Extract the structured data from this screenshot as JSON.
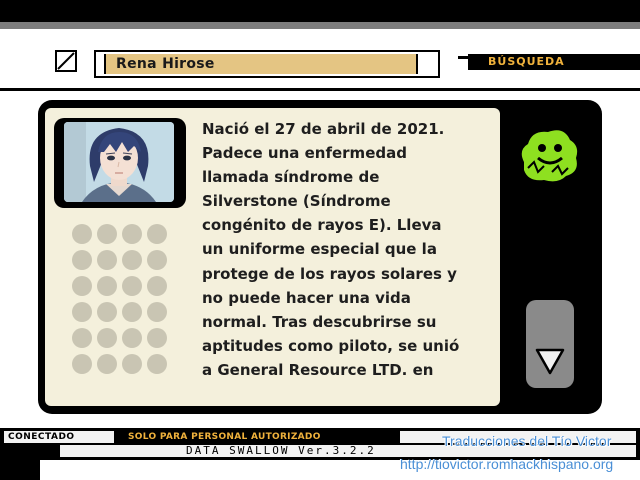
{
  "header": {
    "name": "Rena Hirose",
    "search_label": "BÚSQUEDA"
  },
  "profile": {
    "bio_lines": [
      "Nació el 27 de abril de 2021.",
      "Padece una enfermedad",
      "llamada síndrome de",
      "Silverstone (Síndrome",
      "congénito de rayos E). Lleva",
      "un uniforme especial que la",
      "protege de los rayos solares y",
      "no puede hacer una vida",
      "normal. Tras descubrirse su",
      "aptitudes como piloto, se unió",
      "a General Resource LTD. en"
    ]
  },
  "footer": {
    "status": "CONECTADO",
    "authorized": "SOLO PARA PERSONAL AUTORIZADO",
    "version": "DATA SWALLOW Ver.3.2.2"
  },
  "credits": {
    "line1": "Traducciones del Tío Victor",
    "line2": "http://tiovictor.romhackhispano.org"
  },
  "icons": {
    "slash": "slash-box-icon",
    "logo": "smiley-logo-icon",
    "scroll": "scroll-down-icon"
  },
  "colors": {
    "name_bg": "#e4c583",
    "accent": "#f0b23c",
    "panel": "#000000",
    "content_bg": "#f4f0dc",
    "logo_green": "#8ee020"
  }
}
